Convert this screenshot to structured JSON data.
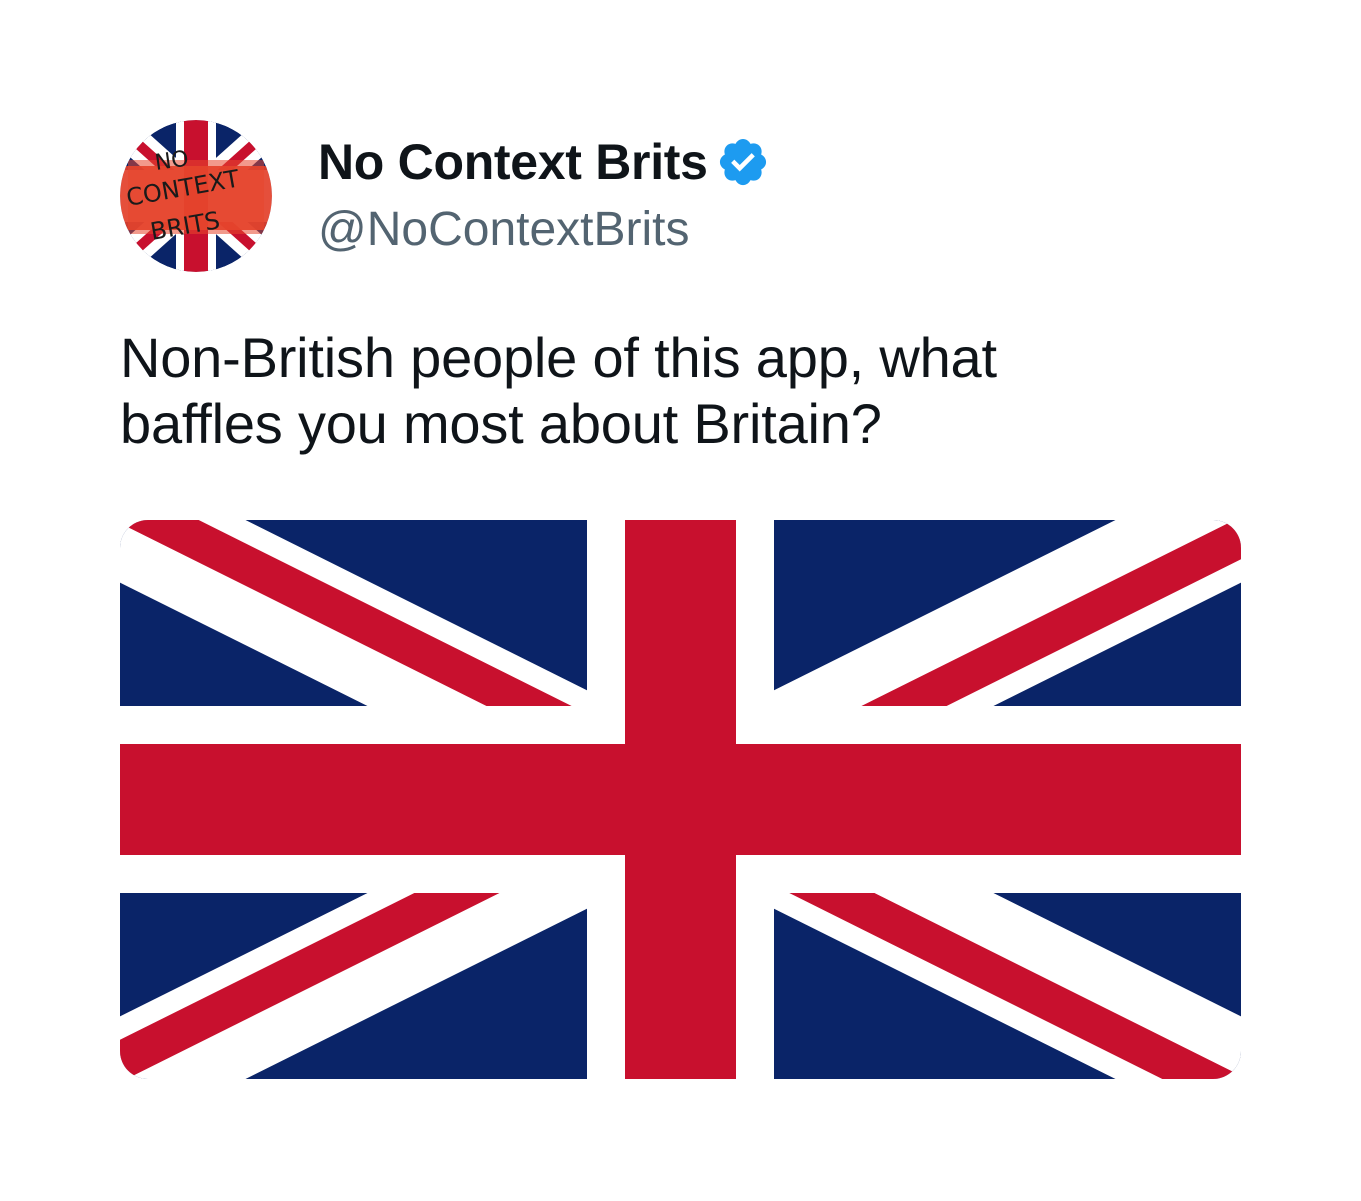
{
  "tweet": {
    "author": {
      "display_name": "No Context Brits",
      "handle": "@NoContextBrits",
      "verified": true,
      "avatar_text": [
        "NO",
        "CONTEXT",
        "BRITS"
      ],
      "avatar_icon": "union-jack-avatar"
    },
    "text_line_1": "Non-British people of this app, what",
    "text_line_2": "baffles you most about Britain?",
    "media": {
      "icon": "union-jack-flag"
    }
  },
  "colors": {
    "flag_blue": "#0a2468",
    "flag_red": "#c8102e",
    "flag_white": "#ffffff",
    "verified_blue": "#1d9bf0",
    "handle_gray": "#536471",
    "text": "#0f1419"
  }
}
